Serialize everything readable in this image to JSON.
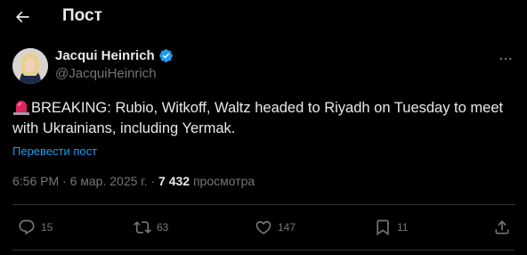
{
  "header": {
    "title": "Пост",
    "back_icon": "arrow-left-icon"
  },
  "author": {
    "display_name": "Jacqui Heinrich",
    "handle": "@JacquiHeinrich",
    "verified": true,
    "verified_color": "#1d9bf0",
    "more_icon": "more-horizontal-icon"
  },
  "tweet": {
    "emoji": "siren-emoji",
    "text_line1": "BREAKING: Rubio, Witkoff, Waltz headed to Riyadh on Tuesday to meet",
    "text_line2": "with Ukrainians, including Yermak.",
    "translate_label": "Перевести пост"
  },
  "meta": {
    "time": "6:56 PM",
    "sep": "·",
    "date": "6 мар. 2025 г.",
    "views_count": "7 432",
    "views_label": "просмотра"
  },
  "actions": {
    "replies": "15",
    "reposts": "63",
    "likes": "147",
    "bookmarks": "11"
  },
  "colors": {
    "background": "#000000",
    "text": "#e7e9ea",
    "muted": "#71767b",
    "accent": "#1d9bf0",
    "divider": "#2f3336"
  }
}
